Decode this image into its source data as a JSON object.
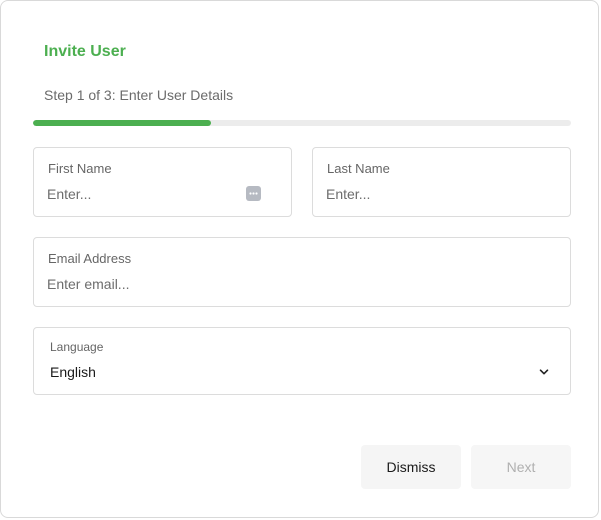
{
  "dialog": {
    "title": "Invite User",
    "step_text": "Step 1 of 3: Enter User Details",
    "progress_fraction": 0.33,
    "accent_color": "#4caf50"
  },
  "form": {
    "first_name": {
      "label": "First Name",
      "placeholder": "Enter...",
      "value": "",
      "icon": "ellipsis-icon"
    },
    "last_name": {
      "label": "Last Name",
      "placeholder": "Enter...",
      "value": ""
    },
    "email": {
      "label": "Email Address",
      "placeholder": "Enter email...",
      "value": ""
    },
    "language": {
      "label": "Language",
      "selected": "English",
      "icon": "chevron-down-icon"
    }
  },
  "actions": {
    "dismiss_label": "Dismiss",
    "next_label": "Next",
    "next_disabled": true
  }
}
